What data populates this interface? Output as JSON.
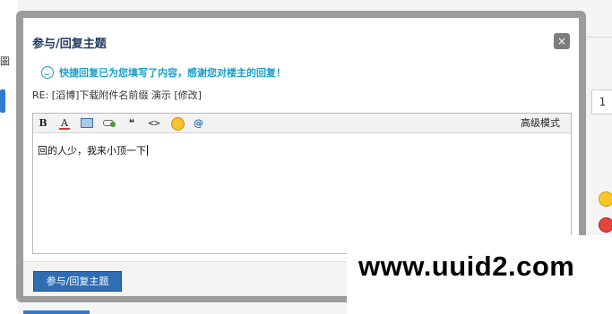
{
  "dialog": {
    "title": "参与/回复主题",
    "close": "×",
    "notice": "快捷回复已为您填写了内容，感谢您对楼主的回复！",
    "notice_icon": "smile-icon",
    "subject": "RE: [滔博]下载附件名前缀 演示 [修改]"
  },
  "toolbar": {
    "bold": "B",
    "font_color": "A",
    "quote": "❝",
    "code": "<>",
    "at": "@",
    "advanced": "高级模式",
    "icons": [
      "bold-icon",
      "font-color-icon",
      "image-icon",
      "link-icon",
      "quote-icon",
      "code-icon",
      "emoticon-icon",
      "at-icon"
    ]
  },
  "editor": {
    "content": "回的人少，我来小顶一下"
  },
  "footer": {
    "submit_label": "参与/回复主题"
  },
  "background": {
    "page_number": "1",
    "left_tab": "圖"
  },
  "watermark": {
    "text": "www.uuid2.com"
  },
  "colors": {
    "accent": "#2f6db5",
    "notice": "#1aa0c8",
    "overlay": "#9c9c9c"
  }
}
